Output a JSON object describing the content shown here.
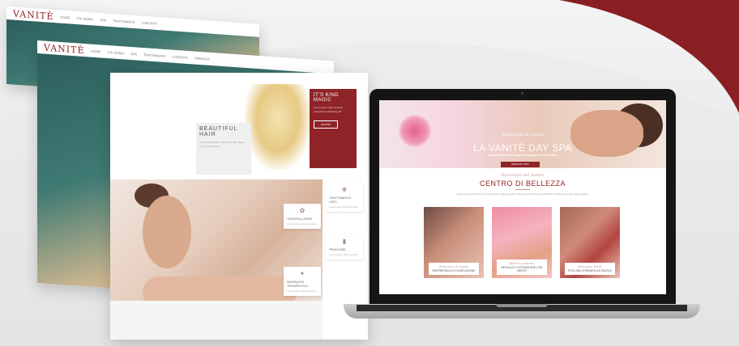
{
  "brand": {
    "logo": "VANITÈ",
    "accent": "#8f2428"
  },
  "back_panel": {
    "nav": [
      "HOME",
      "CHI SIAMO",
      "SPA",
      "TRATTAMENTI",
      "CONTATTI",
      "PRENOTA"
    ]
  },
  "mid_panel": {
    "hair_title": "BEAUTIFUL HAIR",
    "hair_text": "Sed ut perspiciatis unde omnis iste natus error sit voluptatem",
    "magic_title": "IT'S KIND MAGIC",
    "magic_text": "Lorem ipsum dolor sit amet consectetur adipiscing elit",
    "magic_button": "SCOPRI",
    "services": [
      {
        "title": "TRATTAMENTI VISO",
        "desc": "Lorem ipsum dolor sit amet"
      },
      {
        "title": "TERAPIA LASER",
        "desc": "Lorem ipsum dolor sit amet"
      },
      {
        "title": "PEDICURE",
        "desc": "Lorem ipsum dolor sit amet"
      },
      {
        "title": "MASSAGGI TERAPEUTICI",
        "desc": "Lorem ipsum dolor sit amet"
      }
    ]
  },
  "laptop": {
    "hero_subtitle": "Benvenuti da Vanitè",
    "hero_title": "LA VANITÉ DAY SPA",
    "hero_desc": "un posto dove le tue esigenze saranno al centro di tutto",
    "hero_button": "PRENOTA ORA",
    "section_subtitle": "Benvenuti nel nostro",
    "section_title": "CENTRO DI BELLEZZA",
    "section_desc": "Lorem ipsum dolor sit amet, consectetur adipiscing elit, sed do eiusmod tempor incididunt ut labore et dolore magna aliqua.",
    "cards": [
      {
        "script": "Benessere di coppia",
        "title": "ESPERIENZA DI CONDIVISIONE"
      },
      {
        "script": "Bellezza naturale",
        "title": "REGALATI L'ATTENZIONE CHE MERITI"
      },
      {
        "script": "Benessere bimbi",
        "title": "PER UNA GIORNATA DA FAVOLA"
      }
    ]
  }
}
